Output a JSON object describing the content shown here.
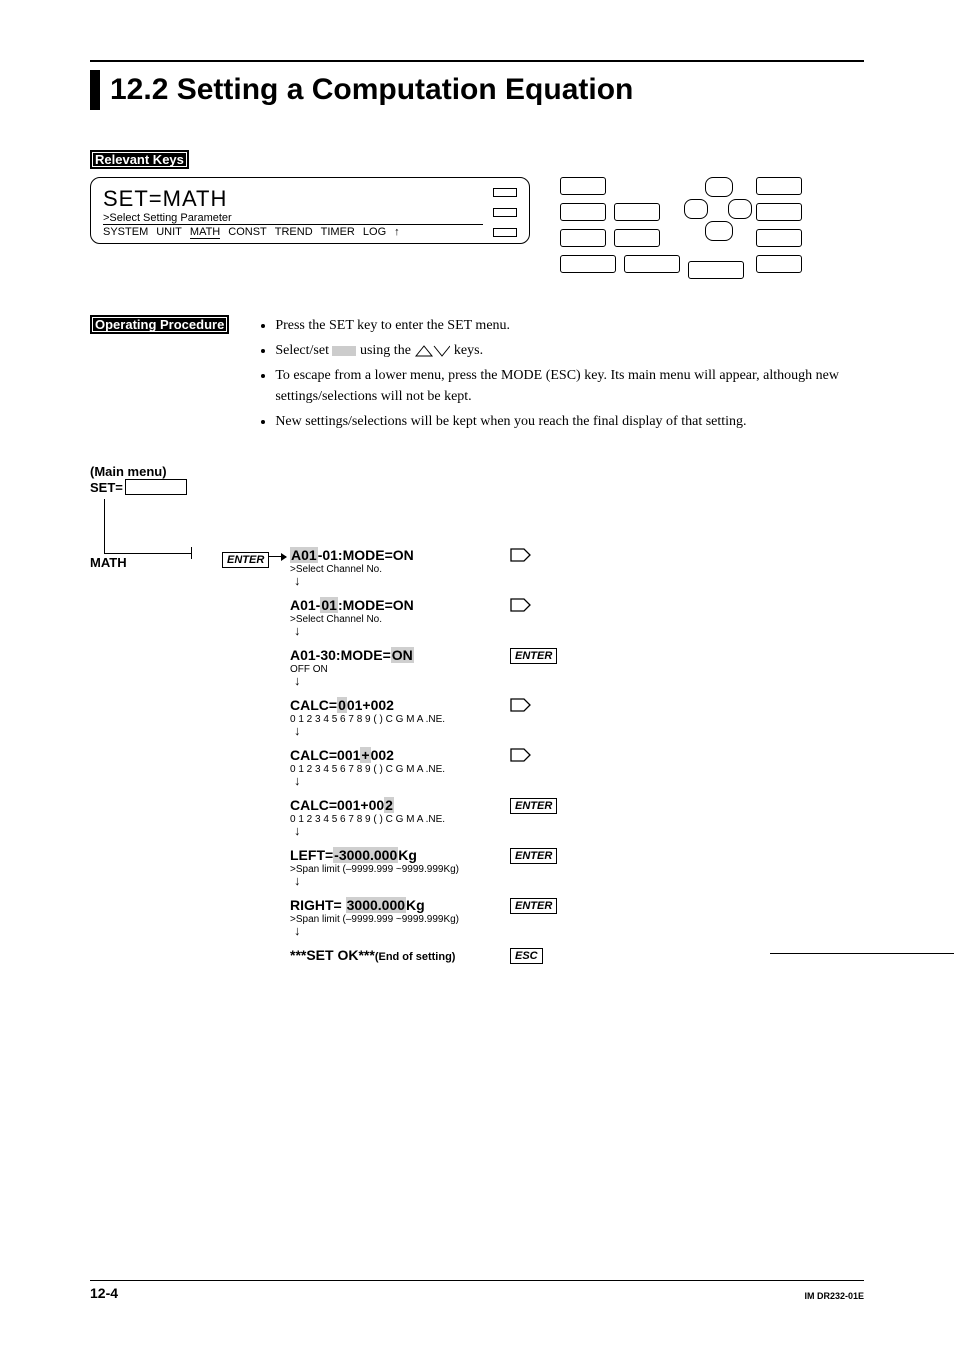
{
  "title": "12.2 Setting a Computation Equation",
  "relevant_keys_label": "Relevant Keys",
  "lcd": {
    "title": "SET=MATH",
    "sub": ">Select Setting Parameter",
    "menu": [
      "SYSTEM",
      "UNIT",
      "MATH",
      "CONST",
      "TREND",
      "TIMER",
      "LOG",
      "↑"
    ]
  },
  "op_proc_label": "Operating Procedure",
  "op_bullets": [
    "Press the SET key to enter the SET menu.",
    "Select/set ▮ using the △▽ keys.",
    "To escape from a lower menu, press the MODE (ESC) key.  Its main menu will appear, although new settings/selections will not be kept.",
    "New settings/selections will be kept when you reach the final display of that setting."
  ],
  "flow": {
    "main_menu": "(Main menu)",
    "set_label": "SET=",
    "math_label": "MATH",
    "enter_label": "ENTER",
    "esc_label": "ESC"
  },
  "steps": [
    {
      "title_pre": "",
      "title_hl": "A01",
      "title_post": "-01:MODE=ON",
      "sub": ">Select Channel No.",
      "action": "right"
    },
    {
      "title_pre": "A01-",
      "title_hl": "01",
      "title_post": ":MODE=ON",
      "sub": ">Select Channel No.",
      "action": "right"
    },
    {
      "title_pre": "A01-30:MODE=",
      "title_hl": "ON",
      "title_post": "",
      "sub": "OFF  ON",
      "action": "enter"
    },
    {
      "title_pre": "CALC=",
      "title_hl": "0",
      "title_post": "01+002",
      "sub": "0 1 2 3 4 5 6 7 8 9 ( ) C G M A .NE.",
      "action": "right"
    },
    {
      "title_pre": "CALC=001",
      "title_hl": "+",
      "title_post": "002",
      "sub": "0 1 2 3 4 5 6 7 8 9 ( ) C G M A .NE.",
      "action": "right"
    },
    {
      "title_pre": "CALC=001+00",
      "title_hl": "2",
      "title_post": "",
      "sub": "0 1 2 3 4 5 6 7 8 9 ( ) C G M A .NE.",
      "action": "enter"
    },
    {
      "title_pre": "LEFT=",
      "title_hl": "-3000.000",
      "title_post": "Kg",
      "sub": ">Span limit (–9999.999 ~9999.999Kg)",
      "action": "enter"
    },
    {
      "title_pre": "RIGHT= ",
      "title_hl": "3000.000",
      "title_post": "Kg",
      "sub": ">Span limit (–9999.999 ~9999.999Kg)",
      "action": "enter"
    },
    {
      "title_pre": "***SET OK***",
      "title_hl": "",
      "title_post": "",
      "sub": "",
      "action": "esc",
      "end_text": "(End of setting)"
    }
  ],
  "footer": {
    "page": "12-4",
    "code": "IM DR232-01E"
  }
}
